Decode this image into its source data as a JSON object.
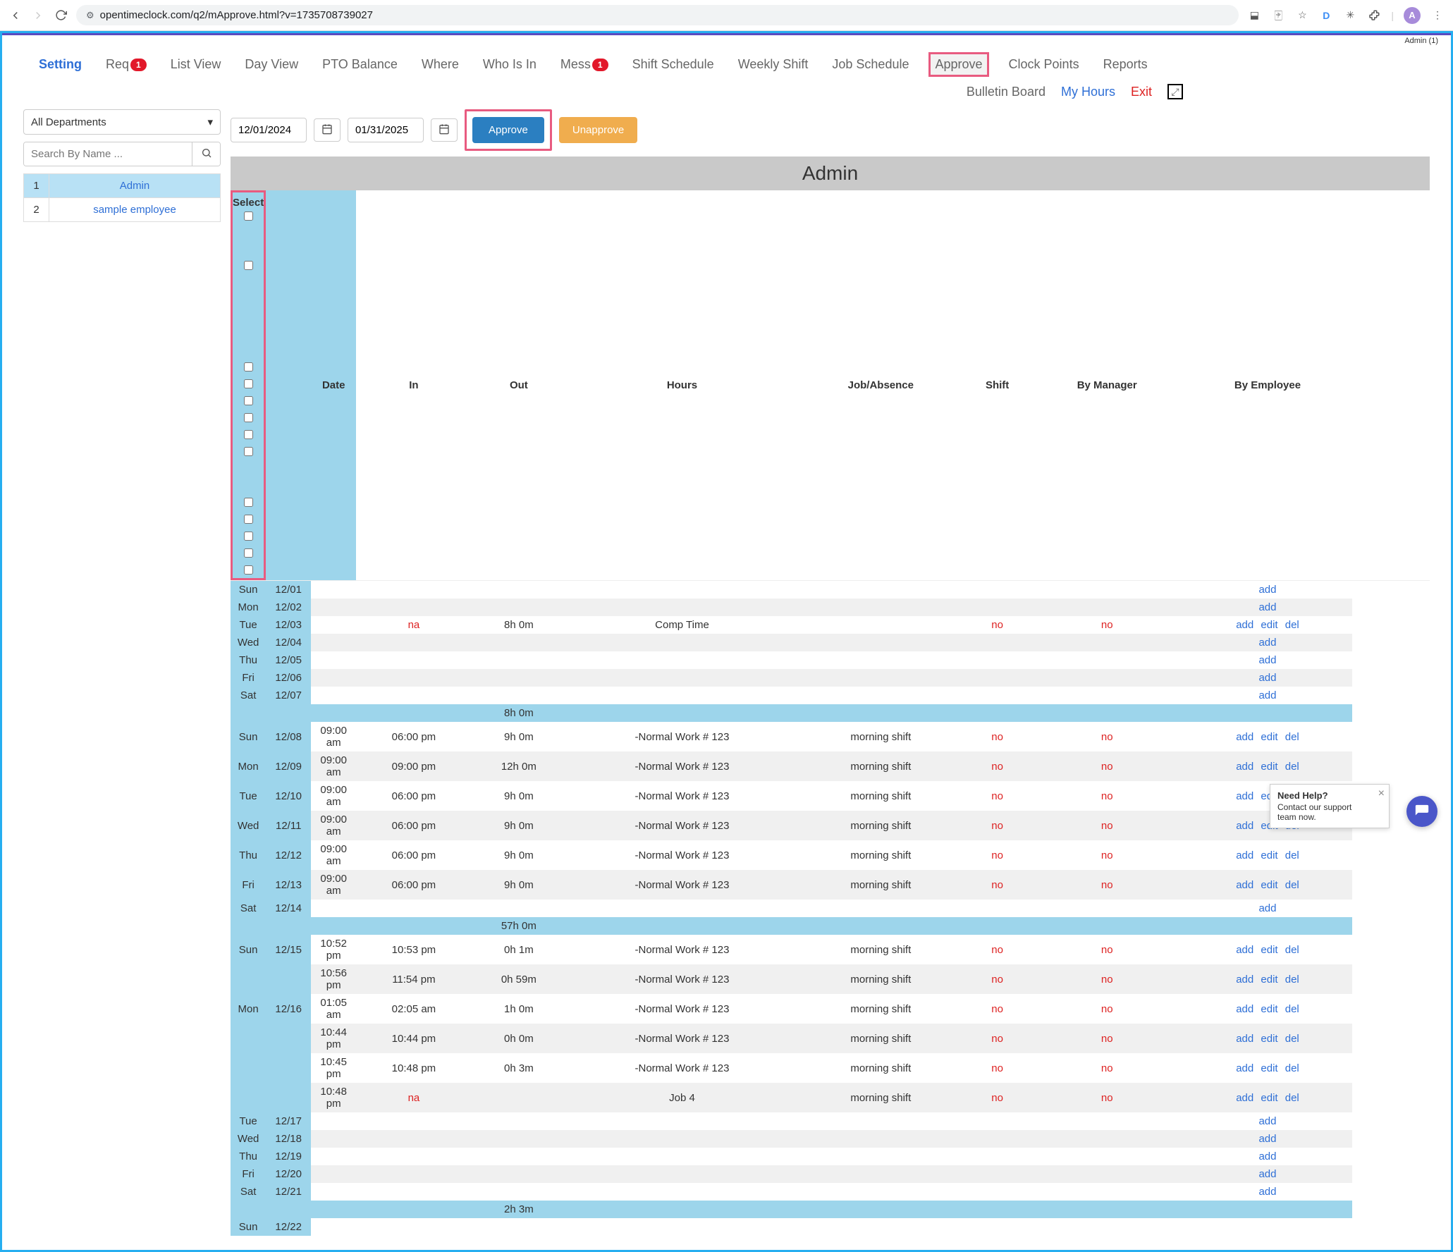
{
  "chrome": {
    "url": "opentimeclock.com/q2/mApprove.html?v=1735708739027",
    "avatar_letter": "A"
  },
  "user_label": "Admin (1)",
  "nav1": {
    "setting": "Setting",
    "req": "Req",
    "req_badge": "1",
    "list_view": "List View",
    "day_view": "Day View",
    "pto": "PTO Balance",
    "where": "Where",
    "whoisin": "Who Is In",
    "mess": "Mess",
    "mess_badge": "1",
    "shift_schedule": "Shift Schedule",
    "weekly_shift": "Weekly Shift",
    "job_schedule": "Job Schedule",
    "approve": "Approve",
    "clock_points": "Clock Points",
    "reports": "Reports"
  },
  "nav2": {
    "bulletin": "Bulletin Board",
    "my_hours": "My Hours",
    "exit": "Exit"
  },
  "filters": {
    "dept": "All Departments",
    "search_ph": "Search By Name ...",
    "date_from": "12/01/2024",
    "date_to": "01/31/2025",
    "approve_btn": "Approve",
    "unapprove_btn": "Unapprove"
  },
  "employees": [
    {
      "idx": "1",
      "name": "Admin",
      "selected": true
    },
    {
      "idx": "2",
      "name": "sample employee",
      "selected": false
    }
  ],
  "main_title": "Admin",
  "columns": {
    "select": "Select",
    "date": "Date",
    "in": "In",
    "out": "Out",
    "hours": "Hours",
    "job": "Job/Absence",
    "shift": "Shift",
    "by_mgr": "By Manager",
    "by_emp": "By Employee"
  },
  "action_labels": {
    "add": "add",
    "edit": "edit",
    "del": "del"
  },
  "rows": [
    {
      "cb": false,
      "day": "Sun",
      "date": "12/01",
      "in": "",
      "out": "",
      "hours": "",
      "job": "",
      "shift": "",
      "mgr": "",
      "emp": "",
      "actions": [
        "add"
      ],
      "zebra": false
    },
    {
      "cb": false,
      "day": "Mon",
      "date": "12/02",
      "in": "",
      "out": "",
      "hours": "",
      "job": "",
      "shift": "",
      "mgr": "",
      "emp": "",
      "actions": [
        "add"
      ],
      "zebra": true
    },
    {
      "cb": true,
      "day": "Tue",
      "date": "12/03",
      "in": "",
      "out": "na",
      "out_red": true,
      "hours": "8h 0m",
      "job": "Comp Time",
      "shift": "",
      "mgr": "no",
      "mgr_red": true,
      "emp": "no",
      "emp_red": true,
      "actions": [
        "add",
        "edit",
        "del"
      ],
      "zebra": false
    },
    {
      "cb": false,
      "day": "Wed",
      "date": "12/04",
      "in": "",
      "out": "",
      "hours": "",
      "job": "",
      "shift": "",
      "mgr": "",
      "emp": "",
      "actions": [
        "add"
      ],
      "zebra": true
    },
    {
      "cb": false,
      "day": "Thu",
      "date": "12/05",
      "in": "",
      "out": "",
      "hours": "",
      "job": "",
      "shift": "",
      "mgr": "",
      "emp": "",
      "actions": [
        "add"
      ],
      "zebra": false
    },
    {
      "cb": false,
      "day": "Fri",
      "date": "12/06",
      "in": "",
      "out": "",
      "hours": "",
      "job": "",
      "shift": "",
      "mgr": "",
      "emp": "",
      "actions": [
        "add"
      ],
      "zebra": true
    },
    {
      "cb": false,
      "day": "Sat",
      "date": "12/07",
      "in": "",
      "out": "",
      "hours": "",
      "job": "",
      "shift": "",
      "mgr": "",
      "emp": "",
      "actions": [
        "add"
      ],
      "zebra": false
    },
    {
      "subtotal": "8h 0m"
    },
    {
      "cb": true,
      "day": "Sun",
      "date": "12/08",
      "in": "09:00 am",
      "out": "06:00 pm",
      "hours": "9h 0m",
      "job": "-Normal Work # 123",
      "shift": "morning shift",
      "mgr": "no",
      "mgr_red": true,
      "emp": "no",
      "emp_red": true,
      "actions": [
        "add",
        "edit",
        "del"
      ],
      "zebra": false
    },
    {
      "cb": true,
      "day": "Mon",
      "date": "12/09",
      "in": "09:00 am",
      "out": "09:00 pm",
      "hours": "12h 0m",
      "job": "-Normal Work # 123",
      "shift": "morning shift",
      "mgr": "no",
      "mgr_red": true,
      "emp": "no",
      "emp_red": true,
      "actions": [
        "add",
        "edit",
        "del"
      ],
      "zebra": true
    },
    {
      "cb": true,
      "day": "Tue",
      "date": "12/10",
      "in": "09:00 am",
      "out": "06:00 pm",
      "hours": "9h 0m",
      "job": "-Normal Work # 123",
      "shift": "morning shift",
      "mgr": "no",
      "mgr_red": true,
      "emp": "no",
      "emp_red": true,
      "actions": [
        "add",
        "edit",
        "del"
      ],
      "zebra": false
    },
    {
      "cb": true,
      "day": "Wed",
      "date": "12/11",
      "in": "09:00 am",
      "out": "06:00 pm",
      "hours": "9h 0m",
      "job": "-Normal Work # 123",
      "shift": "morning shift",
      "mgr": "no",
      "mgr_red": true,
      "emp": "no",
      "emp_red": true,
      "actions": [
        "add",
        "edit",
        "del"
      ],
      "zebra": true
    },
    {
      "cb": true,
      "day": "Thu",
      "date": "12/12",
      "in": "09:00 am",
      "out": "06:00 pm",
      "hours": "9h 0m",
      "job": "-Normal Work # 123",
      "shift": "morning shift",
      "mgr": "no",
      "mgr_red": true,
      "emp": "no",
      "emp_red": true,
      "actions": [
        "add",
        "edit",
        "del"
      ],
      "zebra": false
    },
    {
      "cb": true,
      "day": "Fri",
      "date": "12/13",
      "in": "09:00 am",
      "out": "06:00 pm",
      "hours": "9h 0m",
      "job": "-Normal Work # 123",
      "shift": "morning shift",
      "mgr": "no",
      "mgr_red": true,
      "emp": "no",
      "emp_red": true,
      "actions": [
        "add",
        "edit",
        "del"
      ],
      "zebra": true
    },
    {
      "cb": false,
      "day": "Sat",
      "date": "12/14",
      "in": "",
      "out": "",
      "hours": "",
      "job": "",
      "shift": "",
      "mgr": "",
      "emp": "",
      "actions": [
        "add"
      ],
      "zebra": false
    },
    {
      "subtotal": "57h 0m"
    },
    {
      "cb": true,
      "day": "Sun",
      "date": "12/15",
      "in": "10:52 pm",
      "out": "10:53 pm",
      "hours": "0h 1m",
      "job": "-Normal Work # 123",
      "shift": "morning shift",
      "mgr": "no",
      "mgr_red": true,
      "emp": "no",
      "emp_red": true,
      "actions": [
        "add",
        "edit",
        "del"
      ],
      "zebra": false
    },
    {
      "cb": true,
      "day": "",
      "date": "",
      "in": "10:56 pm",
      "out": "11:54 pm",
      "hours": "0h 59m",
      "job": "-Normal Work # 123",
      "shift": "morning shift",
      "mgr": "no",
      "mgr_red": true,
      "emp": "no",
      "emp_red": true,
      "actions": [
        "add",
        "edit",
        "del"
      ],
      "zebra": true
    },
    {
      "cb": true,
      "day": "Mon",
      "date": "12/16",
      "in": "01:05 am",
      "out": "02:05 am",
      "hours": "1h 0m",
      "job": "-Normal Work # 123",
      "shift": "morning shift",
      "mgr": "no",
      "mgr_red": true,
      "emp": "no",
      "emp_red": true,
      "actions": [
        "add",
        "edit",
        "del"
      ],
      "zebra": false
    },
    {
      "cb": true,
      "day": "",
      "date": "",
      "in": "10:44 pm",
      "out": "10:44 pm",
      "hours": "0h 0m",
      "job": "-Normal Work # 123",
      "shift": "morning shift",
      "mgr": "no",
      "mgr_red": true,
      "emp": "no",
      "emp_red": true,
      "actions": [
        "add",
        "edit",
        "del"
      ],
      "zebra": true
    },
    {
      "cb": true,
      "day": "",
      "date": "",
      "in": "10:45 pm",
      "out": "10:48 pm",
      "hours": "0h 3m",
      "job": "-Normal Work # 123",
      "shift": "morning shift",
      "mgr": "no",
      "mgr_red": true,
      "emp": "no",
      "emp_red": true,
      "actions": [
        "add",
        "edit",
        "del"
      ],
      "zebra": false
    },
    {
      "cb": true,
      "day": "",
      "date": "",
      "in": "10:48 pm",
      "out": "na",
      "out_red": true,
      "hours": "",
      "job": "Job 4",
      "shift": "morning shift",
      "mgr": "no",
      "mgr_red": true,
      "emp": "no",
      "emp_red": true,
      "actions": [
        "add",
        "edit",
        "del"
      ],
      "zebra": true
    },
    {
      "cb": false,
      "day": "Tue",
      "date": "12/17",
      "in": "",
      "out": "",
      "hours": "",
      "job": "",
      "shift": "",
      "mgr": "",
      "emp": "",
      "actions": [
        "add"
      ],
      "zebra": false
    },
    {
      "cb": false,
      "day": "Wed",
      "date": "12/18",
      "in": "",
      "out": "",
      "hours": "",
      "job": "",
      "shift": "",
      "mgr": "",
      "emp": "",
      "actions": [
        "add"
      ],
      "zebra": true
    },
    {
      "cb": false,
      "day": "Thu",
      "date": "12/19",
      "in": "",
      "out": "",
      "hours": "",
      "job": "",
      "shift": "",
      "mgr": "",
      "emp": "",
      "actions": [
        "add"
      ],
      "zebra": false
    },
    {
      "cb": false,
      "day": "Fri",
      "date": "12/20",
      "in": "",
      "out": "",
      "hours": "",
      "job": "",
      "shift": "",
      "mgr": "",
      "emp": "",
      "actions": [
        "add"
      ],
      "zebra": true
    },
    {
      "cb": false,
      "day": "Sat",
      "date": "12/21",
      "in": "",
      "out": "",
      "hours": "",
      "job": "",
      "shift": "",
      "mgr": "",
      "emp": "",
      "actions": [
        "add"
      ],
      "zebra": false
    },
    {
      "subtotal": "2h 3m"
    },
    {
      "cb": false,
      "day": "Sun",
      "date": "12/22",
      "in": "",
      "out": "",
      "hours": "",
      "job": "",
      "shift": "",
      "mgr": "",
      "emp": "",
      "actions": [],
      "zebra": false
    }
  ],
  "help": {
    "title": "Need Help?",
    "body": "Contact our support team now."
  }
}
